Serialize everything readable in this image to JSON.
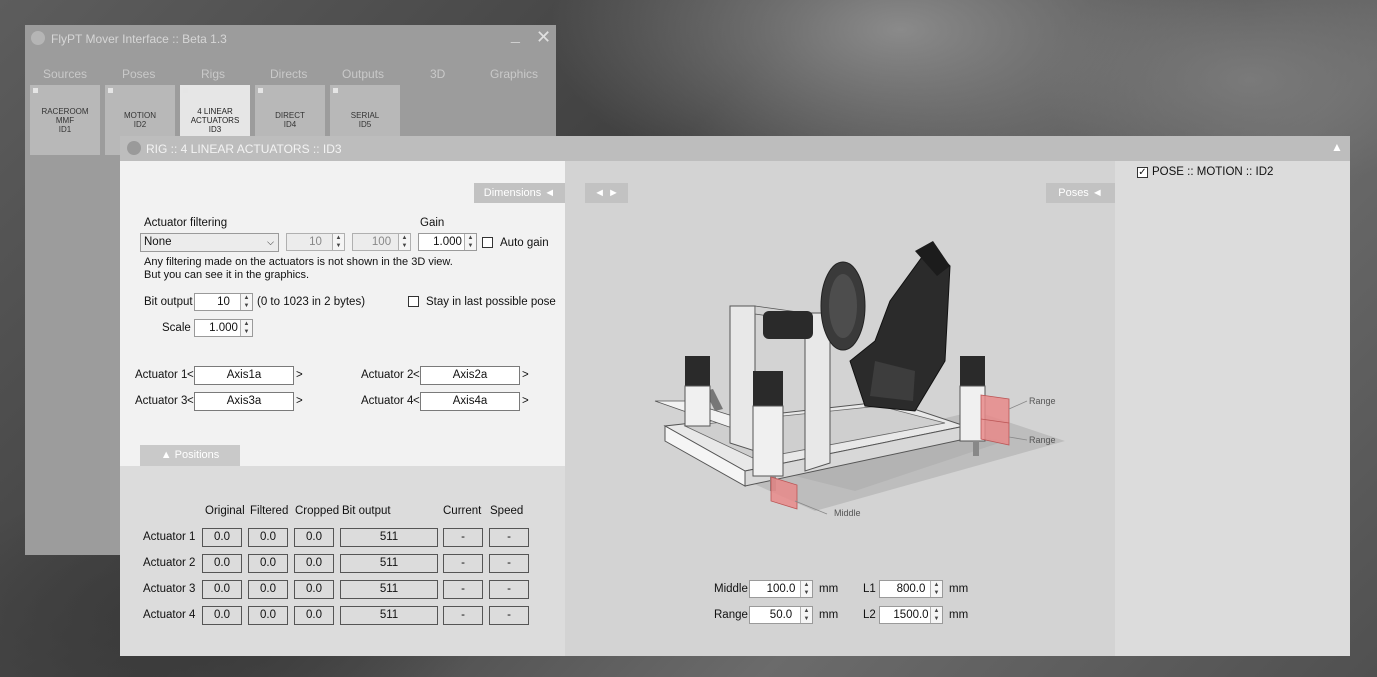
{
  "back_window": {
    "title": "FlyPT Mover Interface :: Beta 1.3",
    "min_glyph": "_",
    "close_glyph": "✕",
    "tabs": [
      "Sources",
      "Poses",
      "Rigs",
      "Directs",
      "Outputs",
      "3D",
      "Graphics"
    ],
    "cards": [
      {
        "line1": "RACEROOM",
        "line2": "MMF",
        "line3": "ID1"
      },
      {
        "line1": "MOTION",
        "line2": "ID2",
        "line3": ""
      },
      {
        "line1": "4 LINEAR",
        "line2": "ACTUATORS",
        "line3": "ID3"
      },
      {
        "line1": "DIRECT",
        "line2": "ID4",
        "line3": ""
      },
      {
        "line1": "SERIAL",
        "line2": "ID5",
        "line3": ""
      }
    ]
  },
  "rig_window": {
    "title": "RIG :: 4 LINEAR ACTUATORS :: ID3",
    "collapse_glyph": "▲",
    "dimensions_tab": "Dimensions  ◄",
    "nav_arrows": "◄  ►",
    "poses_tab": "Poses  ◄",
    "positions_tab": "▲   Positions"
  },
  "filtering": {
    "label": "Actuator filtering",
    "selected": "None",
    "param1": "10",
    "param2": "100",
    "gain_label": "Gain",
    "gain_value": "1.000",
    "auto_gain_label": "Auto gain",
    "note_line1": "Any filtering made on the actuators is not shown in the 3D view.",
    "note_line2": "But you can see it in the graphics."
  },
  "output": {
    "bit_output_label": "Bit output",
    "bit_output_value": "10",
    "bit_output_hint": "(0 to 1023 in 2 bytes)",
    "stay_label": "Stay in last possible pose",
    "scale_label": "Scale",
    "scale_value": "1.000"
  },
  "actuators": [
    {
      "label": "Actuator 1",
      "axis": "Axis1a"
    },
    {
      "label": "Actuator 2",
      "axis": "Axis2a"
    },
    {
      "label": "Actuator 3",
      "axis": "Axis3a"
    },
    {
      "label": "Actuator 4",
      "axis": "Axis4a"
    }
  ],
  "positions": {
    "headers": [
      "Original",
      "Filtered",
      "Cropped",
      "Bit output",
      "Current",
      "Speed"
    ],
    "rows": [
      {
        "label": "Actuator 1",
        "original": "0.0",
        "filtered": "0.0",
        "cropped": "0.0",
        "bit": "511",
        "current": "-",
        "speed": "-"
      },
      {
        "label": "Actuator 2",
        "original": "0.0",
        "filtered": "0.0",
        "cropped": "0.0",
        "bit": "511",
        "current": "-",
        "speed": "-"
      },
      {
        "label": "Actuator 3",
        "original": "0.0",
        "filtered": "0.0",
        "cropped": "0.0",
        "bit": "511",
        "current": "-",
        "speed": "-"
      },
      {
        "label": "Actuator 4",
        "original": "0.0",
        "filtered": "0.0",
        "cropped": "0.0",
        "bit": "511",
        "current": "-",
        "speed": "-"
      }
    ]
  },
  "dimensions": {
    "middle_label": "Middle",
    "middle_value": "100.0",
    "range_label": "Range",
    "range_value": "50.0",
    "l1_label": "L1",
    "l1_value": "800.0",
    "l2_label": "L2",
    "l2_value": "1500.0",
    "unit": "mm"
  },
  "diagram": {
    "callout_range1": "Range",
    "callout_range2": "Range",
    "callout_middle": "Middle"
  },
  "pose": {
    "checked": true,
    "label": "POSE :: MOTION :: ID2"
  }
}
